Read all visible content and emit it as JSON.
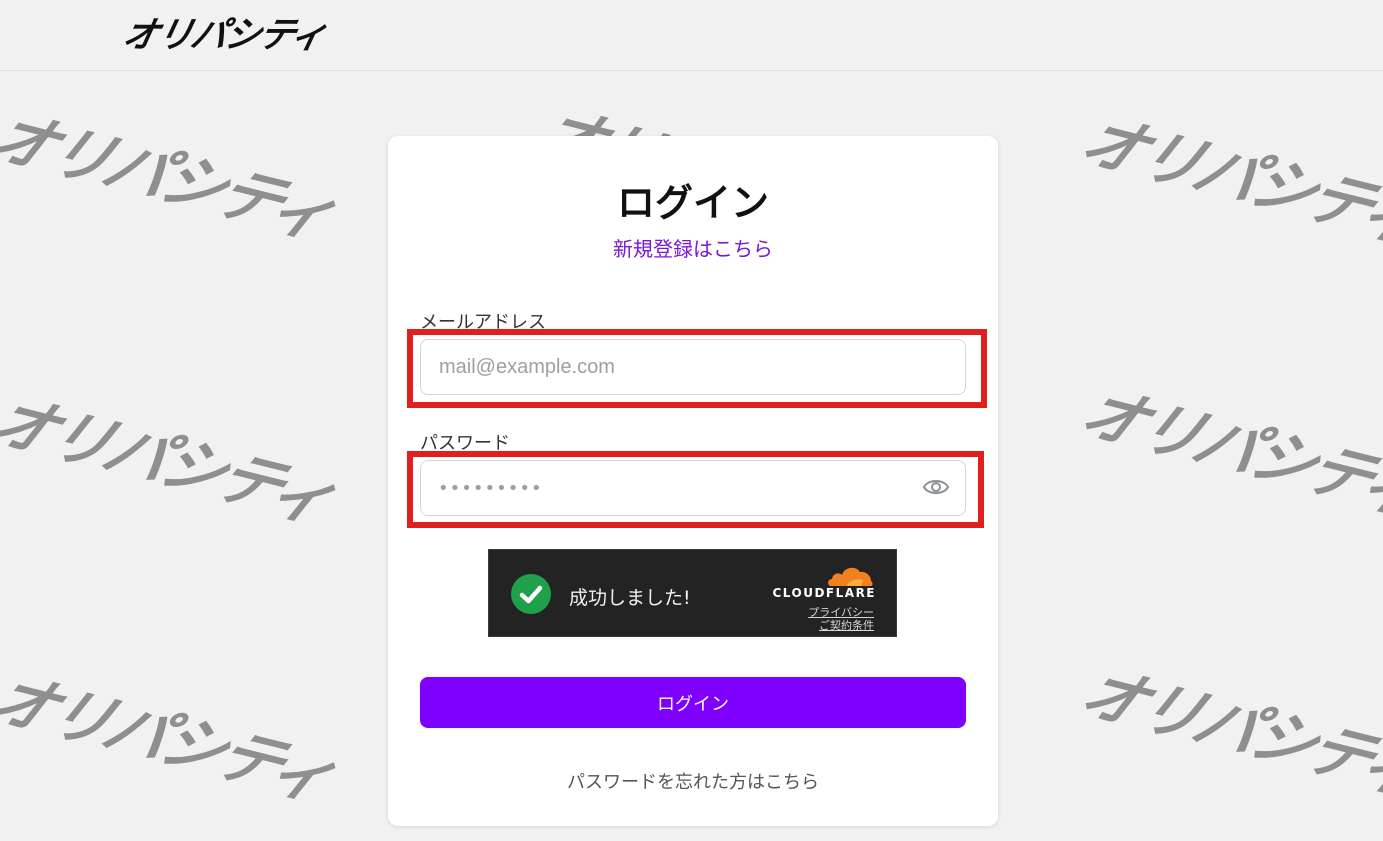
{
  "header": {
    "logo": "オリパシティ"
  },
  "watermark_text": "オリパシティ",
  "login": {
    "title": "ログイン",
    "signup_link": "新規登録はこちら",
    "email_label": "メールアドレス",
    "email_placeholder": "mail@example.com",
    "password_label": "パスワード",
    "password_mask": "•••••••••",
    "submit_label": "ログイン",
    "forgot_link": "パスワードを忘れた方はこちら"
  },
  "captcha": {
    "status": "成功しました!",
    "brand": "CLOUDFLARE",
    "privacy_link": "プライバシー",
    "terms_link": "ご契約条件"
  },
  "colors": {
    "accent": "#7f00ff",
    "link": "#7a16d4",
    "highlight": "#e0201e",
    "success": "#1ea14a",
    "cloudflare_orange": "#f38020"
  },
  "icons": {
    "password_toggle": "eye-icon",
    "captcha_status": "checkmark-icon",
    "captcha_brand": "cloud-icon"
  }
}
